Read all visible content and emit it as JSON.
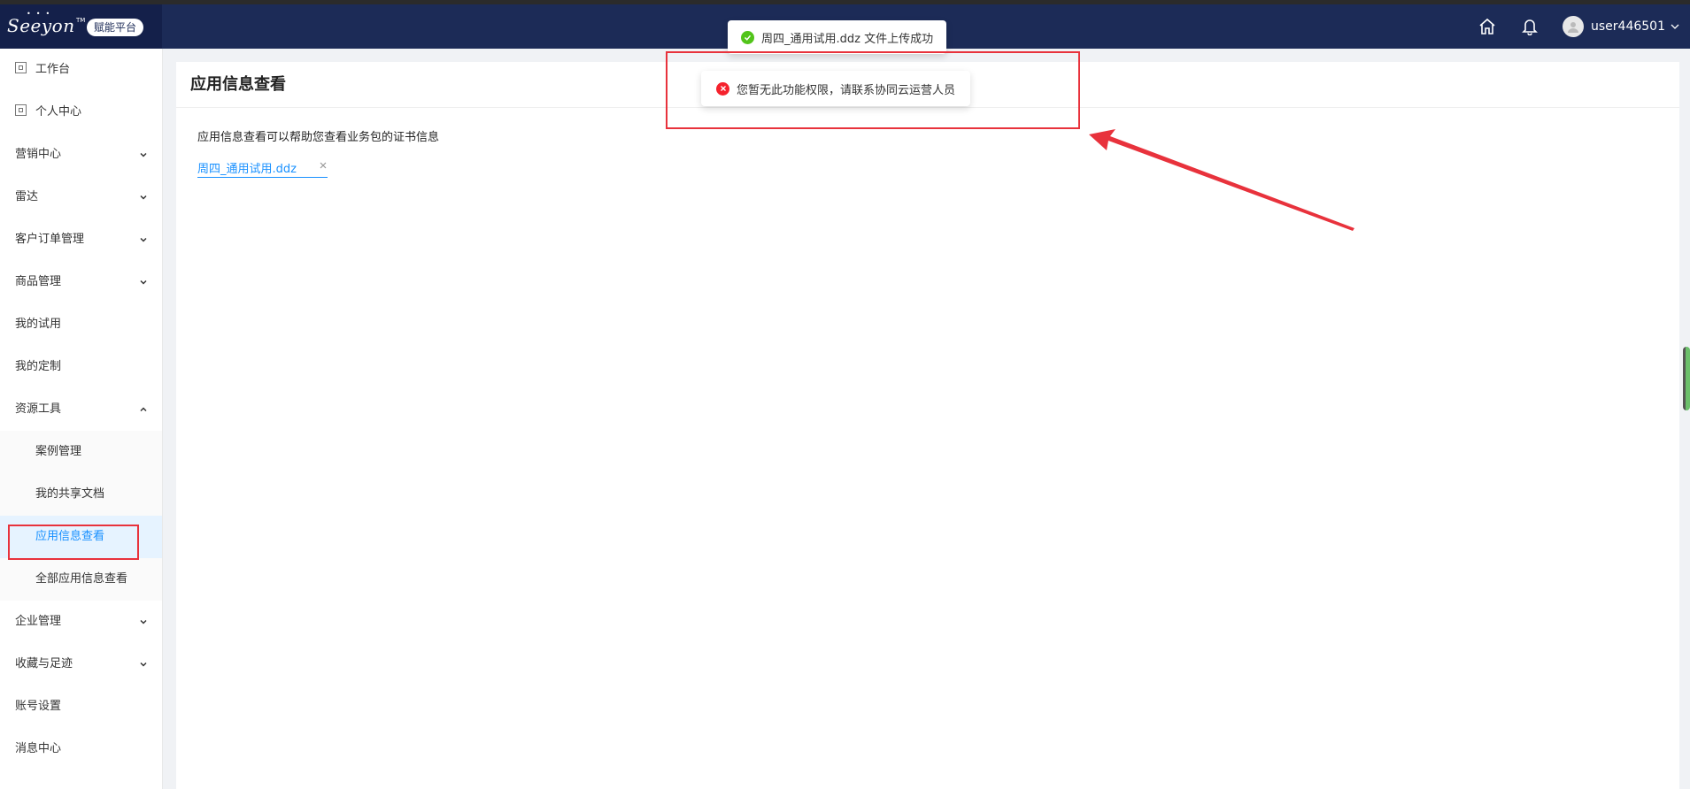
{
  "header": {
    "logo_text": "Seeyon",
    "logo_tm": "TM",
    "platform_label": "赋能平台",
    "username": "user446501",
    "icons": [
      "home-icon",
      "bell-icon",
      "avatar-icon",
      "chevron-down-icon"
    ]
  },
  "sidebar": {
    "items": [
      {
        "label": "工作台",
        "icon": "page-icon"
      },
      {
        "label": "个人中心",
        "icon": "page-icon"
      },
      {
        "label": "营销中心",
        "arrow": "down"
      },
      {
        "label": "雷达",
        "arrow": "down"
      },
      {
        "label": "客户订单管理",
        "arrow": "down"
      },
      {
        "label": "商品管理",
        "arrow": "down"
      },
      {
        "label": "我的试用"
      },
      {
        "label": "我的定制"
      },
      {
        "label": "资源工具",
        "arrow": "up"
      }
    ],
    "sub_items": [
      {
        "label": "案例管理"
      },
      {
        "label": "我的共享文档"
      },
      {
        "label": "应用信息查看",
        "active": true
      },
      {
        "label": "全部应用信息查看"
      }
    ],
    "items_after": [
      {
        "label": "企业管理",
        "arrow": "down"
      },
      {
        "label": "收藏与足迹",
        "arrow": "down"
      },
      {
        "label": "账号设置"
      },
      {
        "label": "消息中心"
      }
    ]
  },
  "main": {
    "title": "应用信息查看",
    "description": "应用信息查看可以帮助您查看业务包的证书信息",
    "file_name": "周四_通用试用.ddz"
  },
  "toasts": {
    "success": "周四_通用试用.ddz 文件上传成功",
    "error": "您暂无此功能权限，请联系协同云运营人员"
  },
  "colors": {
    "header_bg": "#1c2b57",
    "accent": "#1890ff",
    "success": "#52c41a",
    "error": "#f5222d",
    "annotation": "#e8323c"
  }
}
